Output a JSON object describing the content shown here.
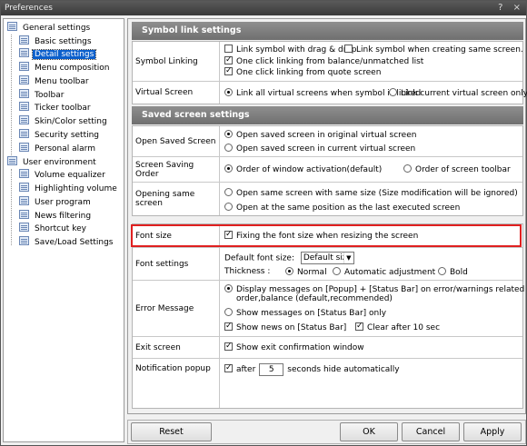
{
  "window": {
    "title": "Preferences",
    "help_glyph": "?",
    "close_glyph": "×"
  },
  "tree": {
    "groups": [
      {
        "label": "General settings",
        "items": [
          "Basic settings",
          "Detail settings",
          "Menu composition",
          "Menu toolbar",
          "Toolbar",
          "Ticker toolbar",
          "Skin/Color setting",
          "Security setting",
          "Personal alarm"
        ]
      },
      {
        "label": "User environment",
        "items": [
          "Volume equalizer",
          "Highlighting volume",
          "User program",
          "News filtering",
          "Shortcut key",
          "Save/Load Settings"
        ]
      }
    ],
    "selected": "Detail settings"
  },
  "symbol_section": {
    "title": "Symbol link settings",
    "linking_label": "Symbol Linking",
    "link_drag": "Link symbol with drag & drop",
    "link_creating": "Link symbol when creating same screen.",
    "one_click_balance": "One click linking from balance/unmatched list",
    "one_click_quote": "One click linking from quote screen",
    "virtual_label": "Virtual Screen",
    "link_all_virtual": "Link all virtual screens when symbol is linked",
    "link_current_virtual": "Link current virtual screen only"
  },
  "saved_section": {
    "title": "Saved screen settings",
    "open_label": "Open Saved Screen",
    "open_original": "Open saved screen in original virtual screen",
    "open_current": "Open saved screen in current virtual screen",
    "order_label": "Screen Saving Order",
    "order_activation": "Order of window activation(default)",
    "order_toolbar": "Order of screen toolbar",
    "same_label": "Opening same screen",
    "same_size": "Open same screen with same size (Size modification will be ignored)",
    "same_position": "Open at the same position as the last executed screen"
  },
  "general_section": {
    "font_size_label": "Font size",
    "fixing_font": "Fixing the font size when resizing the screen",
    "font_settings_label": "Font settings",
    "default_font_size": "Default font size:",
    "default_font_value": "Default size",
    "thickness": "Thickness :",
    "thick_normal": "Normal",
    "thick_auto": "Automatic adjustment",
    "thick_bold": "Bold",
    "error_label": "Error Message",
    "display_popup_1": "Display messages on [Popup] + [Status Bar] on error/warnings related to",
    "display_popup_2": "order,balance (default,recommended)",
    "show_status": "Show messages on [Status Bar] only",
    "show_news": "Show news on [Status Bar]",
    "clear_after": "Clear after 10 sec",
    "exit_label": "Exit screen",
    "exit_confirm": "Show exit confirmation window",
    "notif_label": "Notification popup",
    "after": "after",
    "seconds_value": "5",
    "hide_auto": "seconds hide automatically"
  },
  "buttons": {
    "reset": "Reset",
    "ok": "OK",
    "cancel": "Cancel",
    "apply": "Apply"
  }
}
